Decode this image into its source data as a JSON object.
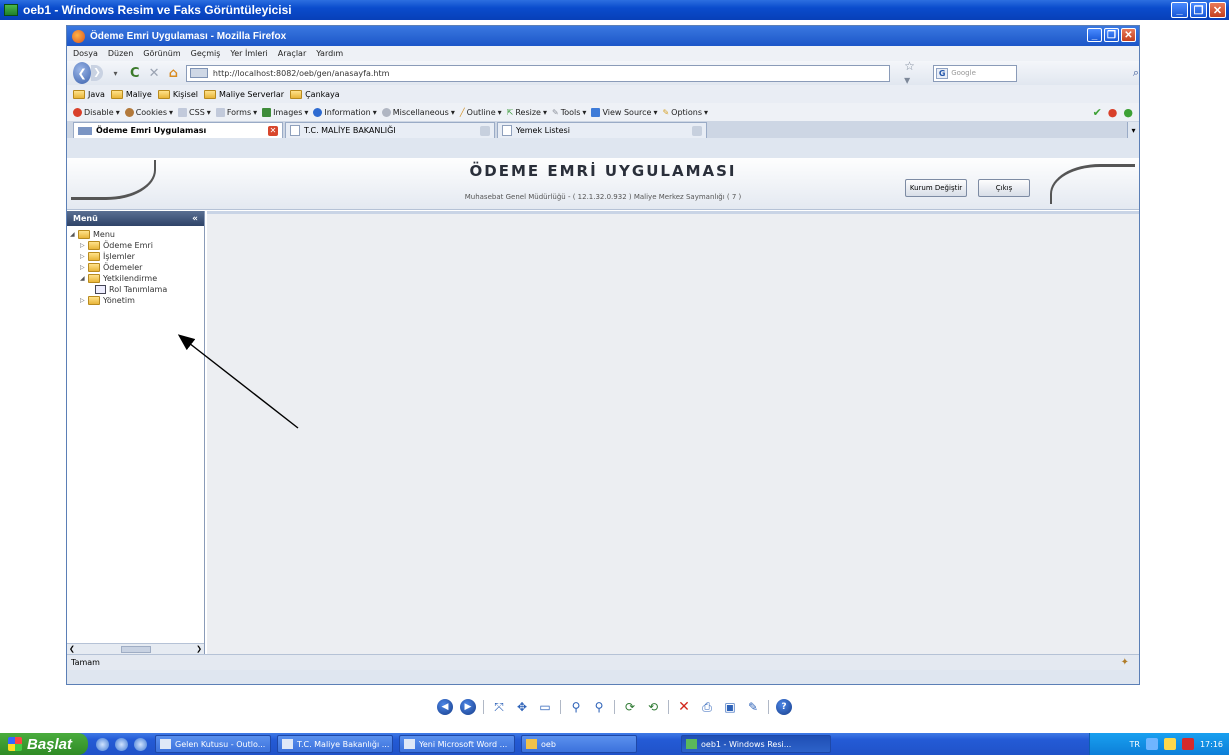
{
  "outer_window": {
    "title": "oeb1 - Windows Resim ve Faks Görüntüleyicisi"
  },
  "firefox": {
    "title": "Ödeme Emri Uygulaması - Mozilla Firefox",
    "menu": [
      "Dosya",
      "Düzen",
      "Görünüm",
      "Geçmiş",
      "Yer İmleri",
      "Araçlar",
      "Yardım"
    ],
    "url": "http://localhost:8082/oeb/gen/anasayfa.htm",
    "search_placeholder": "Google",
    "bookmarks": [
      "Java",
      "Maliye",
      "Kişisel",
      "Maliye Serverlar",
      "Çankaya"
    ],
    "devbar": [
      "Disable",
      "Cookies",
      "CSS",
      "Forms",
      "Images",
      "Information",
      "Miscellaneous",
      "Outline",
      "Resize",
      "Tools",
      "View Source",
      "Options"
    ],
    "tabs": [
      {
        "label": "Ödeme Emri Uygulaması"
      },
      {
        "label": "T.C. MALİYE BAKANLIĞI"
      },
      {
        "label": "Yemek Listesi"
      }
    ],
    "status": "Tamam"
  },
  "app": {
    "title": "ÖDEME EMRİ UYGULAMASI",
    "subtitle": "Muhasebat Genel Müdürlüğü - ( 12.1.32.0.932 ) Maliye Merkez Saymanlığı ( 7 )",
    "buttons": {
      "kurum": "Kurum Değiştir",
      "cikis": "Çıkış"
    },
    "sidebar": {
      "header": "Menü",
      "tree": {
        "root": "Menu",
        "items": [
          "Ödeme Emri",
          "İşlemler",
          "Ödemeler",
          "Yetkilendirme",
          "Yönetim"
        ],
        "sub_item": "Rol Tanımlama"
      }
    }
  },
  "taskbar": {
    "start": "Başlat",
    "buttons": [
      "Gelen Kutusu - Outlo...",
      "T.C. Maliye Bakanlığı ...",
      "Yeni Microsoft Word ...",
      "oeb",
      "oeb1 - Windows Resi..."
    ],
    "lang": "TR",
    "clock": "17:16"
  }
}
